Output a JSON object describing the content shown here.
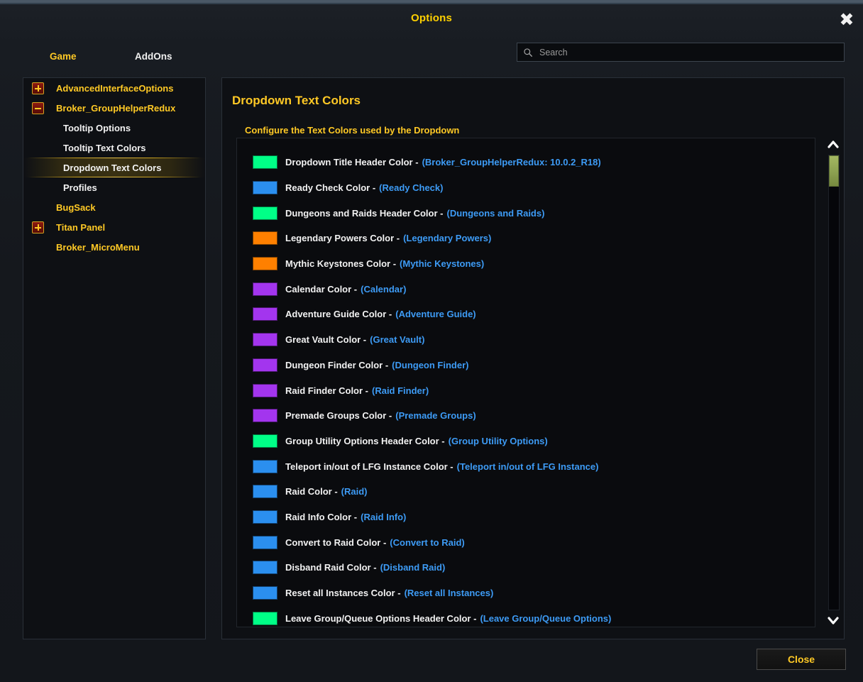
{
  "window": {
    "title": "Options",
    "close_icon": "close-x-icon",
    "close_button_label": "Close"
  },
  "tabs": [
    {
      "label": "Game",
      "active": true
    },
    {
      "label": "AddOns",
      "active": false
    }
  ],
  "search": {
    "icon": "search-icon",
    "value": "",
    "placeholder": "Search"
  },
  "sidebar": {
    "items": [
      {
        "label": "AdvancedInterfaceOptions",
        "level": 0,
        "toggle": "plus",
        "selected": false
      },
      {
        "label": "Broker_GroupHelperRedux",
        "level": 0,
        "toggle": "minus",
        "selected": false
      },
      {
        "label": "Tooltip Options",
        "level": 1,
        "toggle": "none",
        "selected": false
      },
      {
        "label": "Tooltip Text Colors",
        "level": 1,
        "toggle": "none",
        "selected": false
      },
      {
        "label": "Dropdown Text Colors",
        "level": 1,
        "toggle": "none",
        "selected": true
      },
      {
        "label": "Profiles",
        "level": 1,
        "toggle": "none",
        "selected": false
      },
      {
        "label": "BugSack",
        "level": 0,
        "toggle": "none",
        "selected": false
      },
      {
        "label": "Titan Panel",
        "level": 0,
        "toggle": "plus",
        "selected": false
      },
      {
        "label": "Broker_MicroMenu",
        "level": 0,
        "toggle": "none",
        "selected": false
      }
    ]
  },
  "content": {
    "title": "Dropdown Text Colors",
    "subtitle": "Configure the Text Colors used by the Dropdown",
    "rows": [
      {
        "label": "Dropdown Title Header Color -",
        "sample": "(Broker_GroupHelperRedux: 10.0.2_R18)",
        "color": "#00ff87"
      },
      {
        "label": "Ready Check Color -",
        "sample": "(Ready Check)",
        "color": "#2b8fef"
      },
      {
        "label": "Dungeons and Raids Header Color -",
        "sample": "(Dungeons and Raids)",
        "color": "#00ff87"
      },
      {
        "label": "Legendary Powers Color -",
        "sample": "(Legendary Powers)",
        "color": "#ff8000"
      },
      {
        "label": "Mythic Keystones Color -",
        "sample": "(Mythic Keystones)",
        "color": "#ff8000"
      },
      {
        "label": "Calendar Color -",
        "sample": "(Calendar)",
        "color": "#a335ee"
      },
      {
        "label": "Adventure Guide Color -",
        "sample": "(Adventure Guide)",
        "color": "#a335ee"
      },
      {
        "label": "Great Vault Color -",
        "sample": "(Great Vault)",
        "color": "#a335ee"
      },
      {
        "label": "Dungeon Finder Color -",
        "sample": "(Dungeon Finder)",
        "color": "#a335ee"
      },
      {
        "label": "Raid Finder Color -",
        "sample": "(Raid Finder)",
        "color": "#a335ee"
      },
      {
        "label": "Premade Groups Color -",
        "sample": "(Premade Groups)",
        "color": "#a335ee"
      },
      {
        "label": "Group Utility Options Header Color -",
        "sample": "(Group Utility Options)",
        "color": "#00ff87"
      },
      {
        "label": "Teleport in/out of LFG Instance Color -",
        "sample": "(Teleport in/out of LFG Instance)",
        "color": "#2b8fef"
      },
      {
        "label": "Raid Color -",
        "sample": "(Raid)",
        "color": "#2b8fef"
      },
      {
        "label": "Raid Info Color -",
        "sample": "(Raid Info)",
        "color": "#2b8fef"
      },
      {
        "label": "Convert to Raid Color -",
        "sample": "(Convert to Raid)",
        "color": "#2b8fef"
      },
      {
        "label": "Disband Raid Color -",
        "sample": "(Disband Raid)",
        "color": "#2b8fef"
      },
      {
        "label": "Reset all Instances Color -",
        "sample": "(Reset all Instances)",
        "color": "#2b8fef"
      },
      {
        "label": "Leave Group/Queue Options Header Color -",
        "sample": "(Leave Group/Queue Options)",
        "color": "#00ff87"
      }
    ]
  },
  "scrollbar": {
    "up_icon": "chevron-up-icon",
    "down_icon": "chevron-down-icon",
    "thumb_color": "#8ea352"
  }
}
